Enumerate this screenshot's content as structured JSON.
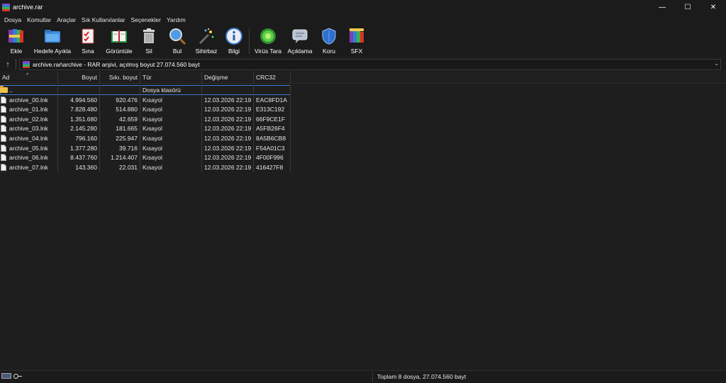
{
  "window": {
    "title": "archive.rar",
    "controls": {
      "minimize": "—",
      "maximize": "☐",
      "close": "✕"
    }
  },
  "menu": [
    "Dosya",
    "Komutlar",
    "Araçlar",
    "Sık Kullanılanlar",
    "Seçenekler",
    "Yardım"
  ],
  "toolbar": [
    {
      "label": "Ekle",
      "icon": "add-books-icon"
    },
    {
      "label": "Hedefe Ayıkla",
      "icon": "extract-folder-icon"
    },
    {
      "label": "Sına",
      "icon": "test-checklist-icon"
    },
    {
      "label": "Görüntüle",
      "icon": "view-book-icon"
    },
    {
      "label": "Sil",
      "icon": "trash-icon"
    },
    {
      "label": "Bul",
      "icon": "magnifier-icon"
    },
    {
      "label": "Sihirbaz",
      "icon": "wizard-wand-icon"
    },
    {
      "label": "Bilgi",
      "icon": "info-icon"
    },
    {
      "label": "Virüs Tara",
      "icon": "virus-scan-icon"
    },
    {
      "label": "Açıklama",
      "icon": "comment-icon"
    },
    {
      "label": "Koru",
      "icon": "shield-icon"
    },
    {
      "label": "SFX",
      "icon": "sfx-books-icon"
    }
  ],
  "address": {
    "up_glyph": "↑",
    "path": "archive.rar\\archive - RAR arşivi, açılmış boyut 27.074.560 bayt",
    "dropdown_glyph": "⌄"
  },
  "columns": {
    "name": "Ad",
    "size": "Boyut",
    "packed": "Sıkı. boyut",
    "type": "Tür",
    "modified": "Değişme",
    "crc": "CRC32",
    "sort_indicator": "^"
  },
  "rows": [
    {
      "name": "..",
      "size": "",
      "packed": "",
      "type": "Dosya klasörü",
      "modified": "",
      "crc": "",
      "kind": "folder"
    },
    {
      "name": "archive_00.lnk",
      "size": "4.994.560",
      "packed": "920.476",
      "type": "Kısayol",
      "modified": "12.03.2026 22:19",
      "crc": "EAC8FD1A",
      "kind": "file"
    },
    {
      "name": "archive_01.lnk",
      "size": "7.828.480",
      "packed": "514.880",
      "type": "Kısayol",
      "modified": "12.03.2026 22:19",
      "crc": "E313C192",
      "kind": "file"
    },
    {
      "name": "archive_02.lnk",
      "size": "1.351.680",
      "packed": "42.659",
      "type": "Kısayol",
      "modified": "12.03.2026 22:19",
      "crc": "66F9CE1F",
      "kind": "file"
    },
    {
      "name": "archive_03.lnk",
      "size": "2.145.280",
      "packed": "181.665",
      "type": "Kısayol",
      "modified": "12.03.2026 22:19",
      "crc": "A5FB26F4",
      "kind": "file"
    },
    {
      "name": "archive_04.lnk",
      "size": "796.160",
      "packed": "225.947",
      "type": "Kısayol",
      "modified": "12.03.2026 22:19",
      "crc": "8A5B6CB8",
      "kind": "file"
    },
    {
      "name": "archive_05.lnk",
      "size": "1.377.280",
      "packed": "39.716",
      "type": "Kısayol",
      "modified": "12.03.2026 22:19",
      "crc": "F54A01C3",
      "kind": "file"
    },
    {
      "name": "archive_06.lnk",
      "size": "8.437.760",
      "packed": "1.214.407",
      "type": "Kısayol",
      "modified": "12.03.2026 22:19",
      "crc": "4F00F996",
      "kind": "file"
    },
    {
      "name": "archive_07.lnk",
      "size": "143.360",
      "packed": "22.031",
      "type": "Kısayol",
      "modified": "12.03.2026 22:19",
      "crc": "416427F8",
      "kind": "file"
    }
  ],
  "status": {
    "summary": "Toplam 8 dosya, 27.074.560 bayt"
  },
  "colors": {
    "background": "#1e1e1e",
    "chrome": "#1b1b1b",
    "selection_outline": "#3d7bd1",
    "folder": "#f1c14b"
  }
}
